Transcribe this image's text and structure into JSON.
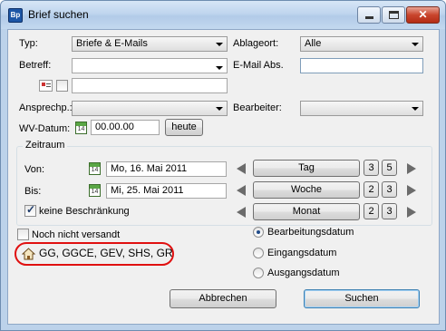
{
  "window": {
    "title": "Brief suchen",
    "app_icon_text": "Bp"
  },
  "caption": {
    "minimize": "minimize-icon",
    "maximize": "maximize-icon",
    "close": "close-icon",
    "close_color": "#c9452d"
  },
  "form": {
    "typ_label": "Typ:",
    "typ_value": "Briefe & E-Mails",
    "ablageort_label": "Ablageort:",
    "ablageort_value": "Alle",
    "betreff_label": "Betreff:",
    "betreff_value": "",
    "email_label": "E-Mail Abs.",
    "email_value": "",
    "extra_value": "",
    "ansprechp_label": "Ansprechp.:",
    "ansprechp_value": "",
    "bearbeiter_label": "Bearbeiter:",
    "bearbeiter_value": "",
    "wv_label": "WV-Datum:",
    "wv_value": "00.00.00",
    "heute_label": "heute"
  },
  "zeitraum": {
    "title": "Zeitraum",
    "von_label": "Von:",
    "von_value": "Mo, 16. Mai 2011",
    "bis_label": "Bis:",
    "bis_value": "Mi, 25. Mai 2011",
    "keine_label": "keine Beschränkung",
    "keine_checked": true,
    "tag_label": "Tag",
    "tag_n1": "3",
    "tag_n2": "5",
    "woche_label": "Woche",
    "woche_n1": "2",
    "woche_n2": "3",
    "monat_label": "Monat",
    "monat_n1": "2",
    "monat_n2": "3"
  },
  "options": {
    "noch_label": "Noch nicht versandt",
    "noch_checked": false,
    "mandant_text": "GG, GGCE, GEV, SHS, GR",
    "radio_options": [
      "Bearbeitungsdatum",
      "Eingangsdatum",
      "Ausgangsdatum"
    ],
    "radio_selected": "Bearbeitungsdatum"
  },
  "buttons": {
    "abbrechen": "Abbrechen",
    "suchen": "Suchen"
  },
  "colors": {
    "highlight_oval": "#e01010",
    "calendar_green": "#5aa645",
    "title_bar": "#bfd5ee"
  }
}
